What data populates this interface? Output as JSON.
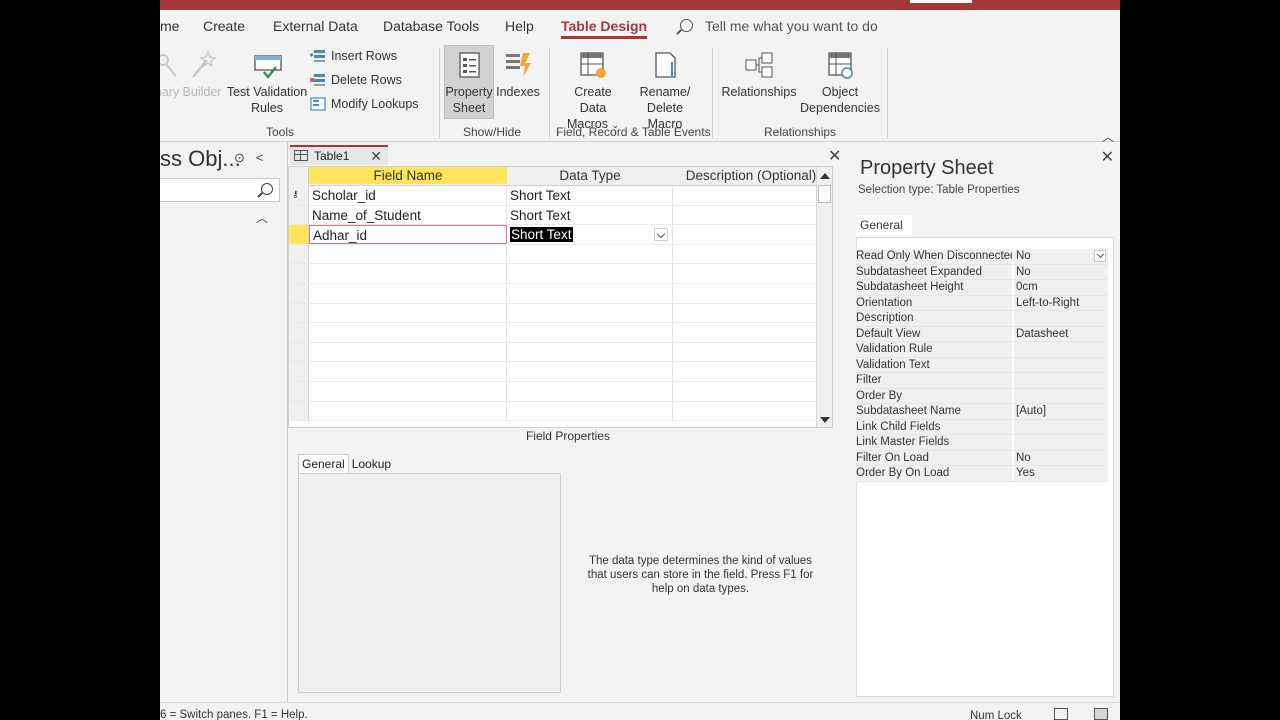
{
  "ribbon_tabs": [
    {
      "label": "me"
    },
    {
      "label": "Create"
    },
    {
      "label": "External Data"
    },
    {
      "label": "Database Tools"
    },
    {
      "label": "Help"
    },
    {
      "label": "Table Design"
    }
  ],
  "tell_me": "Tell me what you want to do",
  "tools_group": {
    "primary_key": "nary",
    "builder": "Builder",
    "test_validation": "Test Validation Rules",
    "insert_rows": "Insert Rows",
    "delete_rows": "Delete Rows",
    "modify_lookups": "Modify Lookups",
    "label": "Tools"
  },
  "showhide_group": {
    "property_sheet": "Property Sheet",
    "indexes": "Indexes",
    "label": "Show/Hide"
  },
  "events_group": {
    "create_data_macros": "Create Data Macros",
    "rename_delete_macro": "Rename/ Delete Macro",
    "label": "Field, Record & Table Events"
  },
  "relationships_group": {
    "relationships": "Relationships",
    "object_dependencies": "Object Dependencies",
    "label": "Relationships"
  },
  "nav_pane": {
    "title": "ss Obj..."
  },
  "doc_tab": {
    "title": "Table1"
  },
  "grid": {
    "headers": {
      "field_name": "Field Name",
      "data_type": "Data Type",
      "description": "Description (Optional)"
    },
    "rows": [
      {
        "field": "Scholar_id",
        "type": "Short Text",
        "desc": ""
      },
      {
        "field": "Name_of_Student",
        "type": "Short Text",
        "desc": ""
      },
      {
        "field": "Adhar_id",
        "type": "Short Text",
        "desc": ""
      }
    ]
  },
  "field_properties": {
    "label": "Field Properties",
    "tab_general": "General",
    "tab_lookup": "Lookup",
    "help": "The data type determines the kind of values that users can store in the field. Press F1 for help on data types."
  },
  "property_sheet": {
    "title": "Property Sheet",
    "selection_type": "Selection type:  Table Properties",
    "tab": "General",
    "rows": [
      {
        "k": "Read Only When Disconnected",
        "v": "No"
      },
      {
        "k": "Subdatasheet Expanded",
        "v": "No"
      },
      {
        "k": "Subdatasheet Height",
        "v": "0cm"
      },
      {
        "k": "Orientation",
        "v": "Left-to-Right"
      },
      {
        "k": "Description",
        "v": ""
      },
      {
        "k": "Default View",
        "v": "Datasheet"
      },
      {
        "k": "Validation Rule",
        "v": ""
      },
      {
        "k": "Validation Text",
        "v": ""
      },
      {
        "k": "Filter",
        "v": ""
      },
      {
        "k": "Order By",
        "v": ""
      },
      {
        "k": "Subdatasheet Name",
        "v": "[Auto]"
      },
      {
        "k": "Link Child Fields",
        "v": ""
      },
      {
        "k": "Link Master Fields",
        "v": ""
      },
      {
        "k": "Filter On Load",
        "v": "No"
      },
      {
        "k": "Order By On Load",
        "v": "Yes"
      }
    ]
  },
  "status": {
    "left": "6 = Switch panes.  F1 = Help.",
    "num_lock": "Num Lock"
  },
  "colors": {
    "accent": "#a4373a",
    "highlight": "#ffe45c"
  }
}
